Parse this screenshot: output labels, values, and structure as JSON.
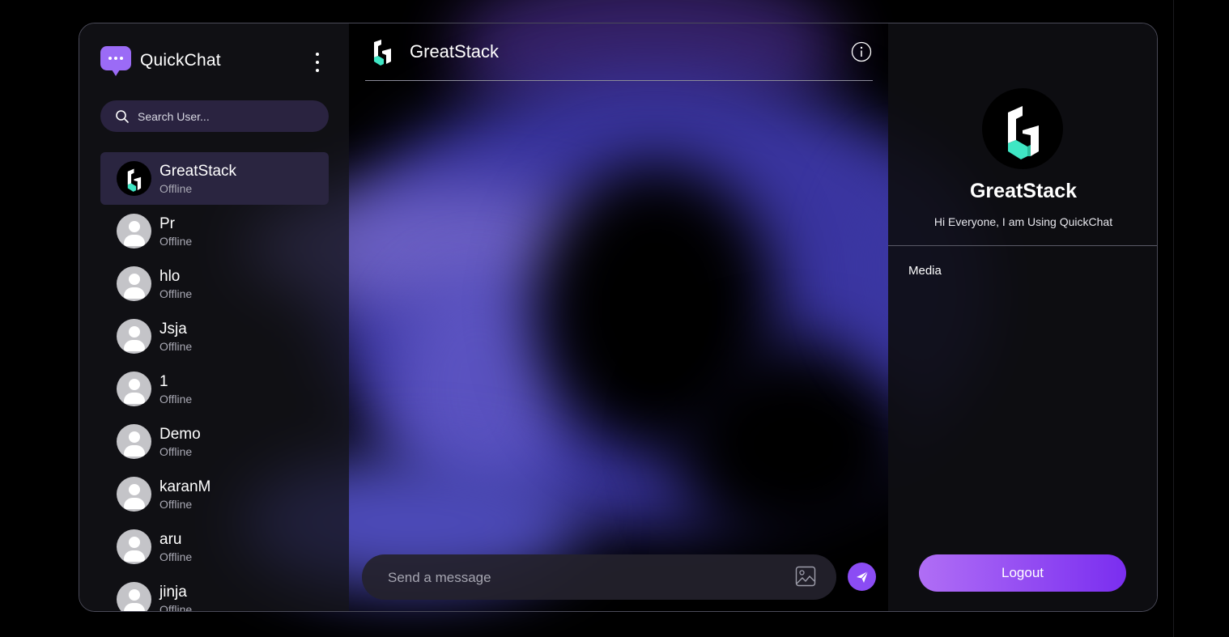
{
  "app": {
    "name": "QuickChat",
    "logo_icon": "chat-bubble-dots-icon",
    "accent": "#8b4cf4"
  },
  "search": {
    "placeholder": "Search User..."
  },
  "users": [
    {
      "name": "GreatStack",
      "status": "Offline",
      "avatar": "greatstack-logo",
      "active": true
    },
    {
      "name": "Pr",
      "status": "Offline",
      "avatar": "default-avatar"
    },
    {
      "name": "hlo",
      "status": "Offline",
      "avatar": "default-avatar"
    },
    {
      "name": "Jsja",
      "status": "Offline",
      "avatar": "default-avatar"
    },
    {
      "name": "1",
      "status": "Offline",
      "avatar": "default-avatar"
    },
    {
      "name": "Demo",
      "status": "Offline",
      "avatar": "default-avatar"
    },
    {
      "name": "karanM",
      "status": "Offline",
      "avatar": "default-avatar"
    },
    {
      "name": "aru",
      "status": "Offline",
      "avatar": "default-avatar"
    },
    {
      "name": "jinja",
      "status": "Offline",
      "avatar": "default-avatar"
    }
  ],
  "chat": {
    "title": "GreatStack",
    "info_icon": "info-icon",
    "message_placeholder": "Send a message",
    "attach_icon": "image-icon",
    "send_icon": "send-icon"
  },
  "profile": {
    "name": "GreatStack",
    "bio": "Hi Everyone, I am Using QuickChat",
    "media_label": "Media",
    "logout_label": "Logout"
  }
}
